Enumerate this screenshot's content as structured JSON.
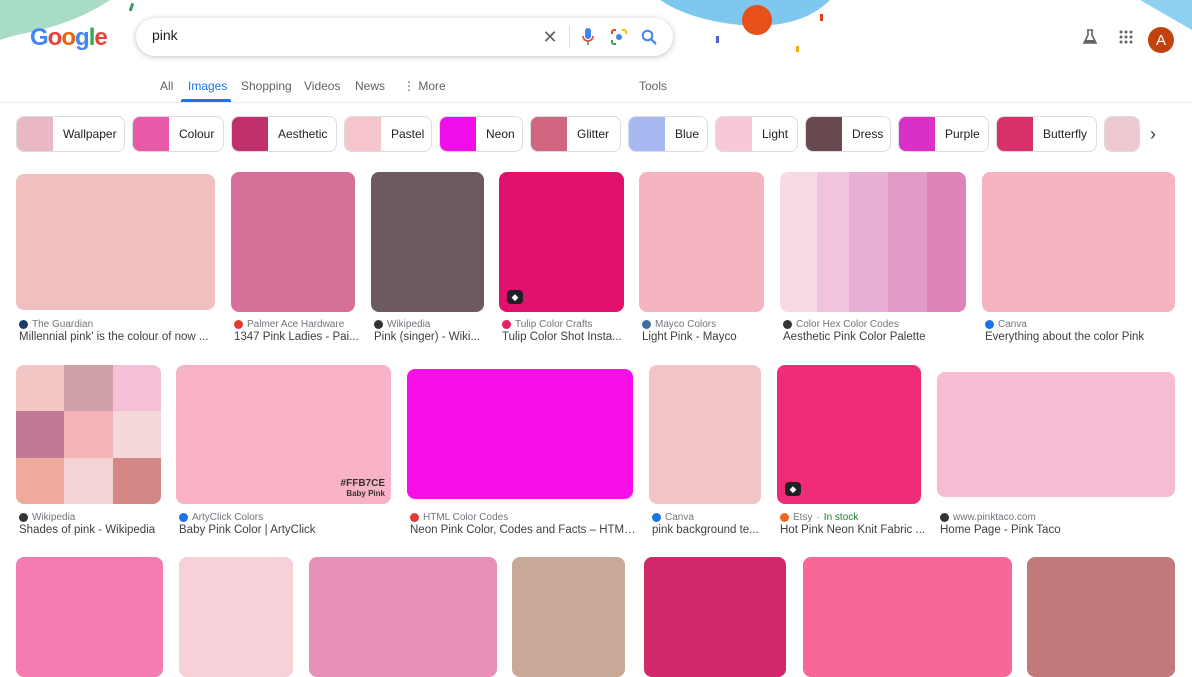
{
  "header": {
    "logo": "Google",
    "query": "pink",
    "user_initial": "A"
  },
  "tabs": [
    "All",
    "Images",
    "Shopping",
    "Videos",
    "News",
    "More",
    "Tools"
  ],
  "chips": [
    {
      "label": "Wallpaper",
      "color": "#eab8c4"
    },
    {
      "label": "Colour",
      "color": "#e85aa8"
    },
    {
      "label": "Aesthetic",
      "color": "#c0306a"
    },
    {
      "label": "Pastel",
      "color": "#f6c6cc"
    },
    {
      "label": "Neon",
      "color": "#f00ee8"
    },
    {
      "label": "Glitter",
      "color": "#d06680"
    },
    {
      "label": "Blue",
      "color": "#a8b8f0"
    },
    {
      "label": "Light",
      "color": "#f7c8d8"
    },
    {
      "label": "Dress",
      "color": "#6a4a50"
    },
    {
      "label": "Purple",
      "color": "#d930c8"
    },
    {
      "label": "Butterfly",
      "color": "#d8306a"
    },
    {
      "label": "",
      "color": "#f0c8d0"
    }
  ],
  "results": [
    {
      "source": "The Guardian",
      "title": "Millennial pink' is the colour of now ...",
      "color": "#f0c0c0",
      "fav": "#1a3a6a"
    },
    {
      "source": "Palmer Ace Hardware",
      "title": "1347 Pink Ladies - Pai...",
      "color": "#d77098",
      "fav": "#e53935"
    },
    {
      "source": "Wikipedia",
      "title": "Pink (singer) - Wiki...",
      "color": "#6b5a5e",
      "fav": "#333"
    },
    {
      "source": "Tulip Color Crafts",
      "title": "Tulip Color Shot Insta...",
      "color": "#e0106c",
      "fav": "#e91e63",
      "badge": true
    },
    {
      "source": "Mayco Colors",
      "title": "Light Pink - Mayco",
      "color": "#f5b5c0",
      "fav": "#3a6ea5"
    },
    {
      "source": "Color Hex Color Codes",
      "title": "Aesthetic Pink Color Palette",
      "color": "palette",
      "fav": "#333"
    },
    {
      "source": "Canva",
      "title": "Everything about the color Pink",
      "color": "#f6b4c0",
      "fav": "#1a73e8"
    },
    {
      "source": "Wikipedia",
      "title": "Shades of pink - Wikipedia",
      "color": "grid",
      "fav": "#333"
    },
    {
      "source": "ArtyClick Colors",
      "title": "Baby Pink Color | ArtyClick",
      "color": "#f8b3c6",
      "fav": "#1a73e8",
      "overlay": "#FFB7CE",
      "overlay2": "Baby Pink"
    },
    {
      "source": "HTML Color Codes",
      "title": "Neon Pink Color, Codes and Facts – HTML...",
      "color": "#f80ee8",
      "fav": "#e53935"
    },
    {
      "source": "Canva",
      "title": "pink background te...",
      "color": "#f1c4c6",
      "fav": "#1a73e8"
    },
    {
      "source": "Etsy",
      "stock": "In stock",
      "title": "Hot Pink Neon Knit Fabric ...",
      "color": "#f02c78",
      "fav": "#f1641e",
      "badge": true
    },
    {
      "source": "www.pinktaco.com",
      "title": "Home Page - Pink Taco",
      "color": "#f6bcd4",
      "fav": "#333"
    },
    {
      "color": "#f47cb0"
    },
    {
      "color": "#f8d0d8"
    },
    {
      "color": "#e890b8"
    },
    {
      "color": "#c8a898"
    },
    {
      "color": "#d02868"
    },
    {
      "color": "#f86896"
    },
    {
      "color": "#c07a7a"
    }
  ]
}
